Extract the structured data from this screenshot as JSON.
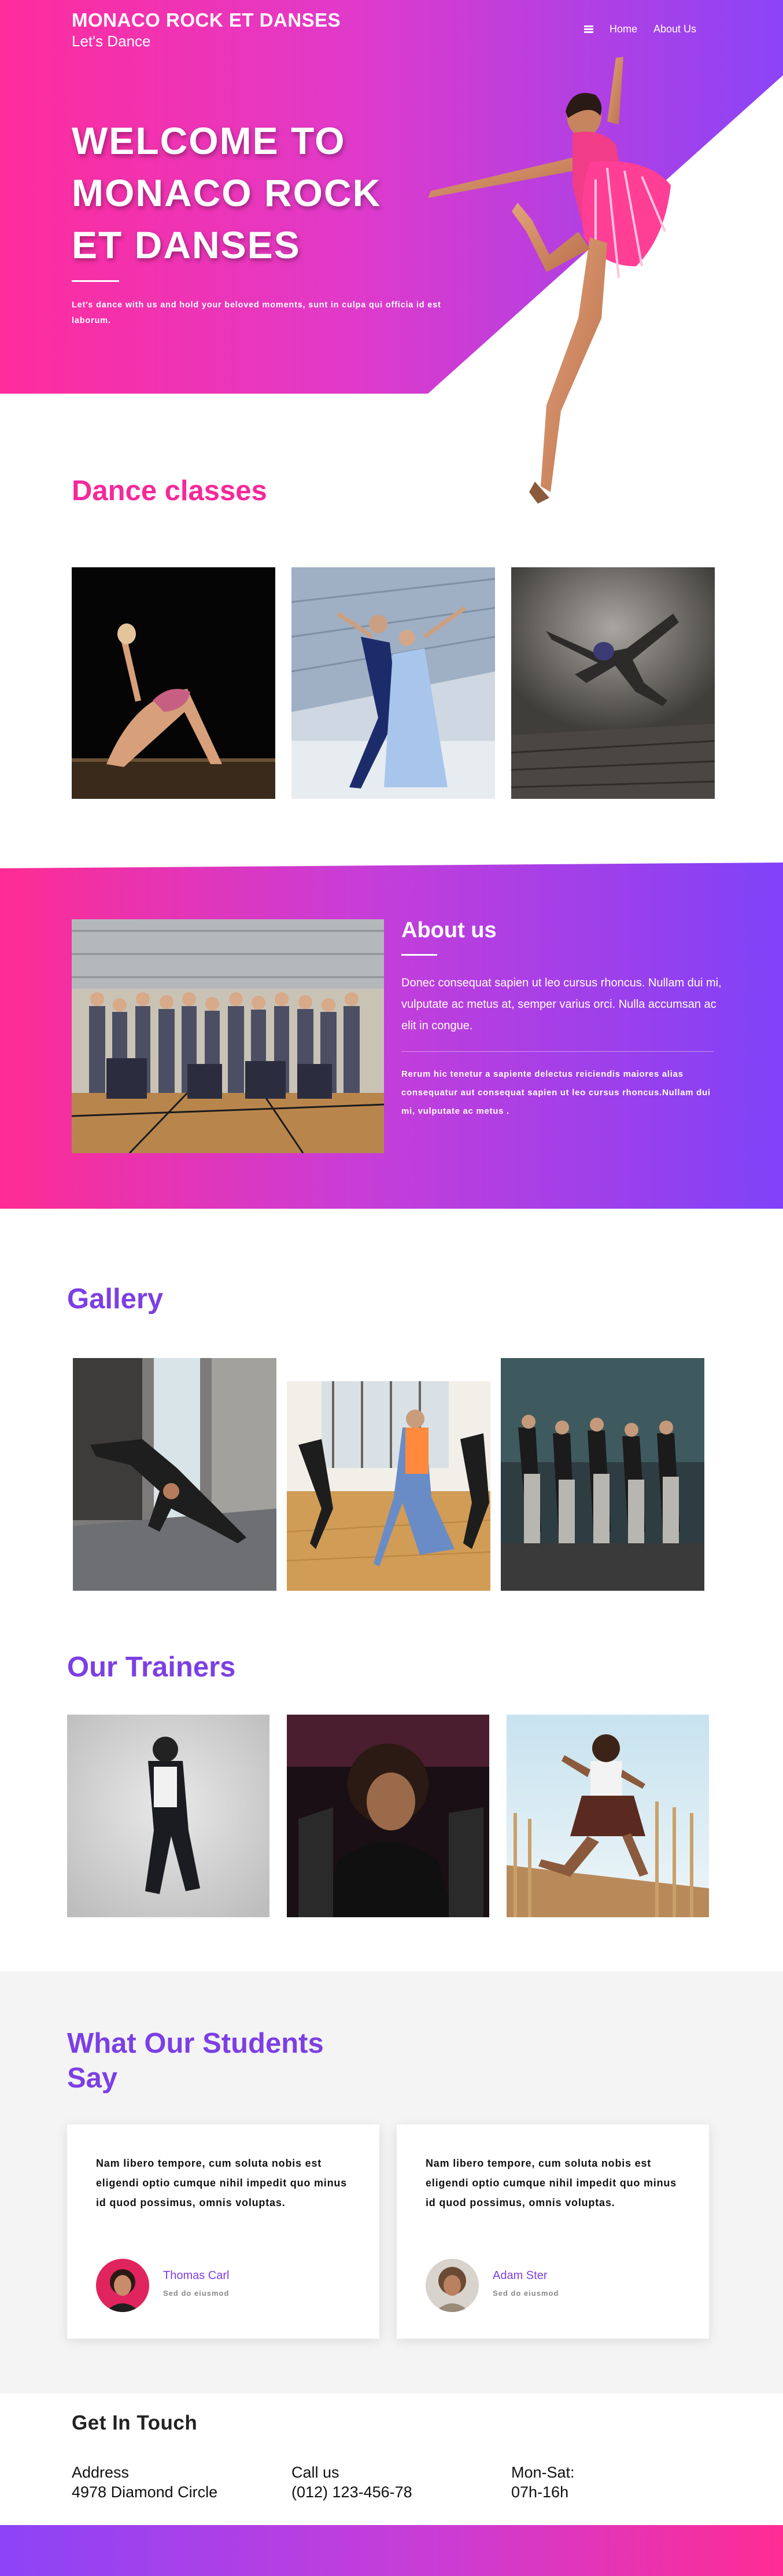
{
  "brand": {
    "title": "MONACO ROCK ET DANSES",
    "tagline": "Let's Dance"
  },
  "nav": {
    "menu_icon": "hamburger-icon",
    "items": [
      "Home",
      "About Us"
    ]
  },
  "hero": {
    "title_line1": "WELCOME TO",
    "title_line2": "MONACO ROCK",
    "title_line3": "ET DANSES",
    "text": "Let's dance with us and hold your beloved moments, sunt in culpa qui officia id est laborum."
  },
  "classes": {
    "title": "Dance classes"
  },
  "about": {
    "title": "About us",
    "paragraph1": "Donec consequat sapien ut leo cursus rhoncus. Nullam dui mi, vulputate ac metus at, semper varius orci. Nulla accumsan ac elit in congue.",
    "paragraph2": "Rerum hic tenetur a sapiente delectus reiciendis maiores alias consequatur aut consequat sapien ut leo cursus rhoncus.Nullam dui mi, vulputate ac metus ."
  },
  "gallery": {
    "title": "Gallery"
  },
  "trainers": {
    "title": "Our Trainers"
  },
  "testimonials": {
    "title": "What Our Students Say",
    "cards": [
      {
        "text": "Nam libero tempore, cum soluta nobis est eligendi optio cumque nihil impedit quo minus id quod possimus, omnis voluptas.",
        "name": "Thomas Carl",
        "role": "Sed do eiusmod"
      },
      {
        "text": "Nam libero tempore, cum soluta nobis est eligendi optio cumque nihil impedit quo minus id quod possimus, omnis voluptas.",
        "name": "Adam Ster",
        "role": "Sed do eiusmod"
      }
    ]
  },
  "contact": {
    "title": "Get In Touch",
    "address_label": "Address",
    "address_value": "4978 Diamond Circle",
    "phone_label": "Call us",
    "phone_value": "(012) 123-456-78",
    "hours_label": "Mon-Sat:",
    "hours_value": "07h-16h"
  },
  "colors": {
    "pink": "#f5299a",
    "purple": "#7c3fe4",
    "gradient_start": "#ff2c9c",
    "gradient_end": "#8b44f7"
  }
}
